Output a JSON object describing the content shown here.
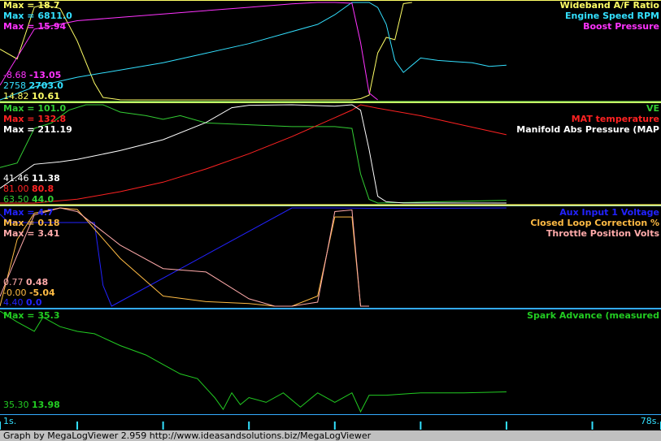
{
  "chart_data": [
    {
      "type": "line",
      "panel": 1,
      "series": [
        {
          "name": "Wideband A/F Ratio",
          "color": "#ffff66",
          "max_label": "Max = 18.7",
          "min_label": "14.82",
          "cur_label": "10.61",
          "x": [
            1,
            3,
            5,
            6,
            8,
            10,
            12,
            13,
            15,
            17,
            20,
            25,
            30,
            33,
            36,
            38,
            40,
            41,
            42,
            43,
            44,
            45,
            46,
            47,
            48,
            49
          ],
          "y": [
            14.82,
            14.0,
            18.3,
            18.5,
            18.2,
            15.5,
            12.0,
            10.8,
            10.61,
            10.6,
            10.6,
            10.6,
            10.6,
            10.6,
            10.6,
            10.6,
            10.6,
            10.6,
            10.6,
            10.7,
            11.0,
            14.5,
            15.8,
            15.6,
            18.6,
            18.7
          ]
        },
        {
          "name": "Engine Speed RPM",
          "color": "#33e0ff",
          "max_label": "Max = 6811.0",
          "min_label": "2758",
          "cur_label": "2703.0",
          "x": [
            1,
            5,
            10,
            15,
            20,
            25,
            30,
            35,
            38,
            40,
            42,
            44,
            45,
            46,
            47,
            48,
            50,
            52,
            54,
            56,
            58,
            60
          ],
          "y": [
            2758,
            3300,
            3700,
            4000,
            4300,
            4700,
            5100,
            5600,
            5900,
            6300,
            6811,
            6811,
            6600,
            5900,
            4400,
            3900,
            4500,
            4400,
            4350,
            4300,
            4150,
            4200
          ]
        },
        {
          "name": "Boost Pressure",
          "color": "#ff33ff",
          "max_label": "Max = 15.94",
          "min_label": "-8.68",
          "cur_label": "-13.05",
          "x": [
            1,
            5,
            8,
            10,
            15,
            20,
            25,
            30,
            35,
            38,
            40,
            42,
            43,
            44,
            45
          ],
          "y": [
            -8.68,
            8.0,
            9.5,
            10.5,
            11.5,
            12.5,
            13.5,
            14.5,
            15.5,
            15.94,
            15.94,
            15.7,
            4.0,
            -11.0,
            -13.05
          ]
        }
      ]
    },
    {
      "type": "line",
      "panel": 2,
      "series": [
        {
          "name": "VE",
          "color": "#33cc33",
          "max_label": "Max = 101.0",
          "min_label": "63.50",
          "cur_label": "44.0",
          "x": [
            1,
            3,
            5,
            7,
            9,
            11,
            13,
            15,
            18,
            20,
            22,
            25,
            30,
            35,
            40,
            42,
            43,
            44,
            45,
            50,
            55,
            60
          ],
          "y": [
            63.5,
            66,
            85,
            88,
            95,
            98,
            98,
            94,
            92,
            90,
            92,
            88,
            87,
            86,
            86,
            85,
            60,
            46,
            44,
            44.5,
            45,
            45.5
          ]
        },
        {
          "name": "MAT temperature",
          "color": "#ff2222",
          "max_label": "Max = 132.8",
          "min_label": "81.00",
          "cur_label": "80.8",
          "x": [
            1,
            5,
            10,
            15,
            20,
            25,
            30,
            35,
            40,
            42,
            43,
            45,
            50,
            55,
            60
          ],
          "y": [
            81,
            81,
            83,
            87,
            92,
            99,
            107,
            116,
            126,
            130,
            132.8,
            131,
            127,
            122,
            117
          ]
        },
        {
          "name": "Manifold Abs Pressure (MAP",
          "color": "#ffffff",
          "max_label": "Max = 211.19",
          "min_label": "41.46",
          "cur_label": "11.38",
          "x": [
            1,
            5,
            8,
            10,
            15,
            20,
            25,
            28,
            30,
            35,
            40,
            42,
            43,
            44,
            45,
            46,
            48,
            60
          ],
          "y": [
            41.46,
            90,
            95,
            100,
            118,
            140,
            175,
            205,
            210,
            211,
            208,
            211,
            200,
            120,
            25,
            14,
            11.5,
            11.38
          ]
        }
      ]
    },
    {
      "type": "line",
      "panel": 3,
      "series": [
        {
          "name": "Aux Input 1 Voltage",
          "color": "#2222ff",
          "max_label": "Max = 4.7",
          "min_label": "4.40",
          "cur_label": "0.0",
          "x": [
            1,
            2,
            12,
            13,
            14,
            35,
            40,
            45,
            50,
            60
          ],
          "y": [
            4.4,
            4.0,
            4.0,
            1.0,
            0.0,
            4.7,
            4.7,
            4.68,
            4.68,
            4.7
          ]
        },
        {
          "name": "Closed Loop Correction %",
          "color": "#ffbb44",
          "max_label": "Max = 0.18",
          "min_label": "-0.00",
          "cur_label": "-5.04",
          "x": [
            1,
            3,
            5,
            8,
            10,
            15,
            20,
            25,
            30,
            33,
            35,
            38,
            40,
            42,
            43,
            44
          ],
          "y": [
            -5.04,
            -1.5,
            -0.1,
            0.18,
            0.1,
            -2.5,
            -4.5,
            -4.8,
            -4.9,
            -5.04,
            -5.04,
            -4.5,
            -0.3,
            -0.3,
            -5.04,
            -5.04
          ]
        },
        {
          "name": "Throttle Position Volts",
          "color": "#ffaaaa",
          "max_label": "Max = 3.41",
          "min_label": "0.77",
          "cur_label": "0.48",
          "x": [
            1,
            3,
            5,
            8,
            10,
            15,
            20,
            25,
            30,
            33,
            35,
            38,
            40,
            42,
            43,
            44
          ],
          "y": [
            0.77,
            2.0,
            3.2,
            3.41,
            3.3,
            2.3,
            1.6,
            1.5,
            0.7,
            0.48,
            0.48,
            0.6,
            3.3,
            3.35,
            0.48,
            0.48
          ]
        }
      ]
    },
    {
      "type": "line",
      "panel": 4,
      "series": [
        {
          "name": "Spark Advance (measured",
          "color": "#22cc22",
          "max_label": "Max = 35.3",
          "min_label": "35.30",
          "cur_label": "13.98",
          "x": [
            1,
            3,
            5,
            6,
            8,
            10,
            12,
            15,
            18,
            20,
            22,
            24,
            25,
            26,
            27,
            28,
            29,
            30,
            32,
            34,
            36,
            38,
            40,
            42,
            43,
            44,
            46,
            50,
            55,
            60
          ],
          "y": [
            35.3,
            33,
            31,
            34,
            32,
            31,
            30.5,
            28,
            26,
            24,
            22,
            21,
            19,
            17,
            14.5,
            18,
            15.5,
            17,
            16,
            18,
            15,
            18,
            16,
            18,
            14,
            17.5,
            17.5,
            18,
            18,
            18.2
          ]
        }
      ]
    }
  ],
  "axis": {
    "start": "1s.",
    "end": "78s."
  },
  "footer": "Graph by MegaLogViewer 2.959 http://www.ideasandsolutions.biz/MegaLogViewer"
}
